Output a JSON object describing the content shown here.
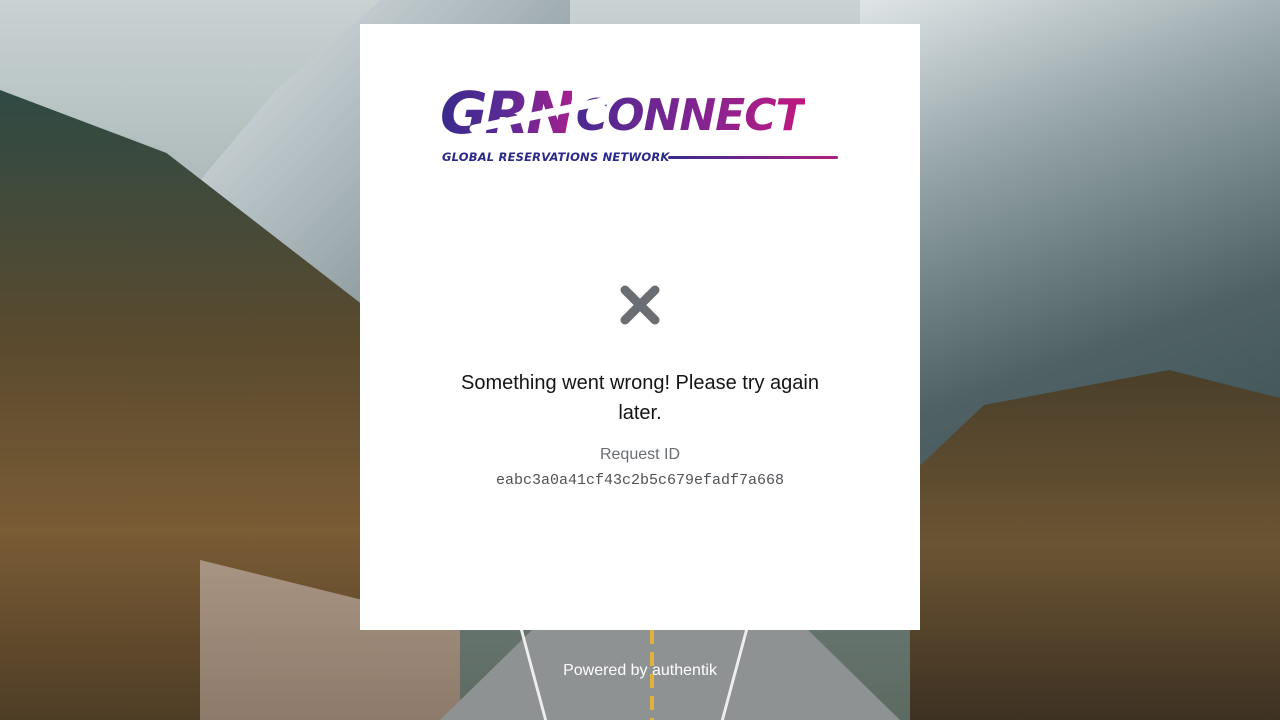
{
  "brand": {
    "logo_primary": "GRN",
    "logo_secondary": "CONNECT",
    "tagline": "GLOBAL RESERVATIONS NETWORK",
    "colors": {
      "purple": "#3a2a8c",
      "magenta": "#c0187e"
    }
  },
  "error": {
    "icon": "close-icon",
    "message": "Something went wrong! Please try again later.",
    "request_id_label": "Request ID",
    "request_id": "eabc3a0a41cf43c2b5c679efadf7a668"
  },
  "footer": {
    "link_text": "Powered by authentik"
  }
}
